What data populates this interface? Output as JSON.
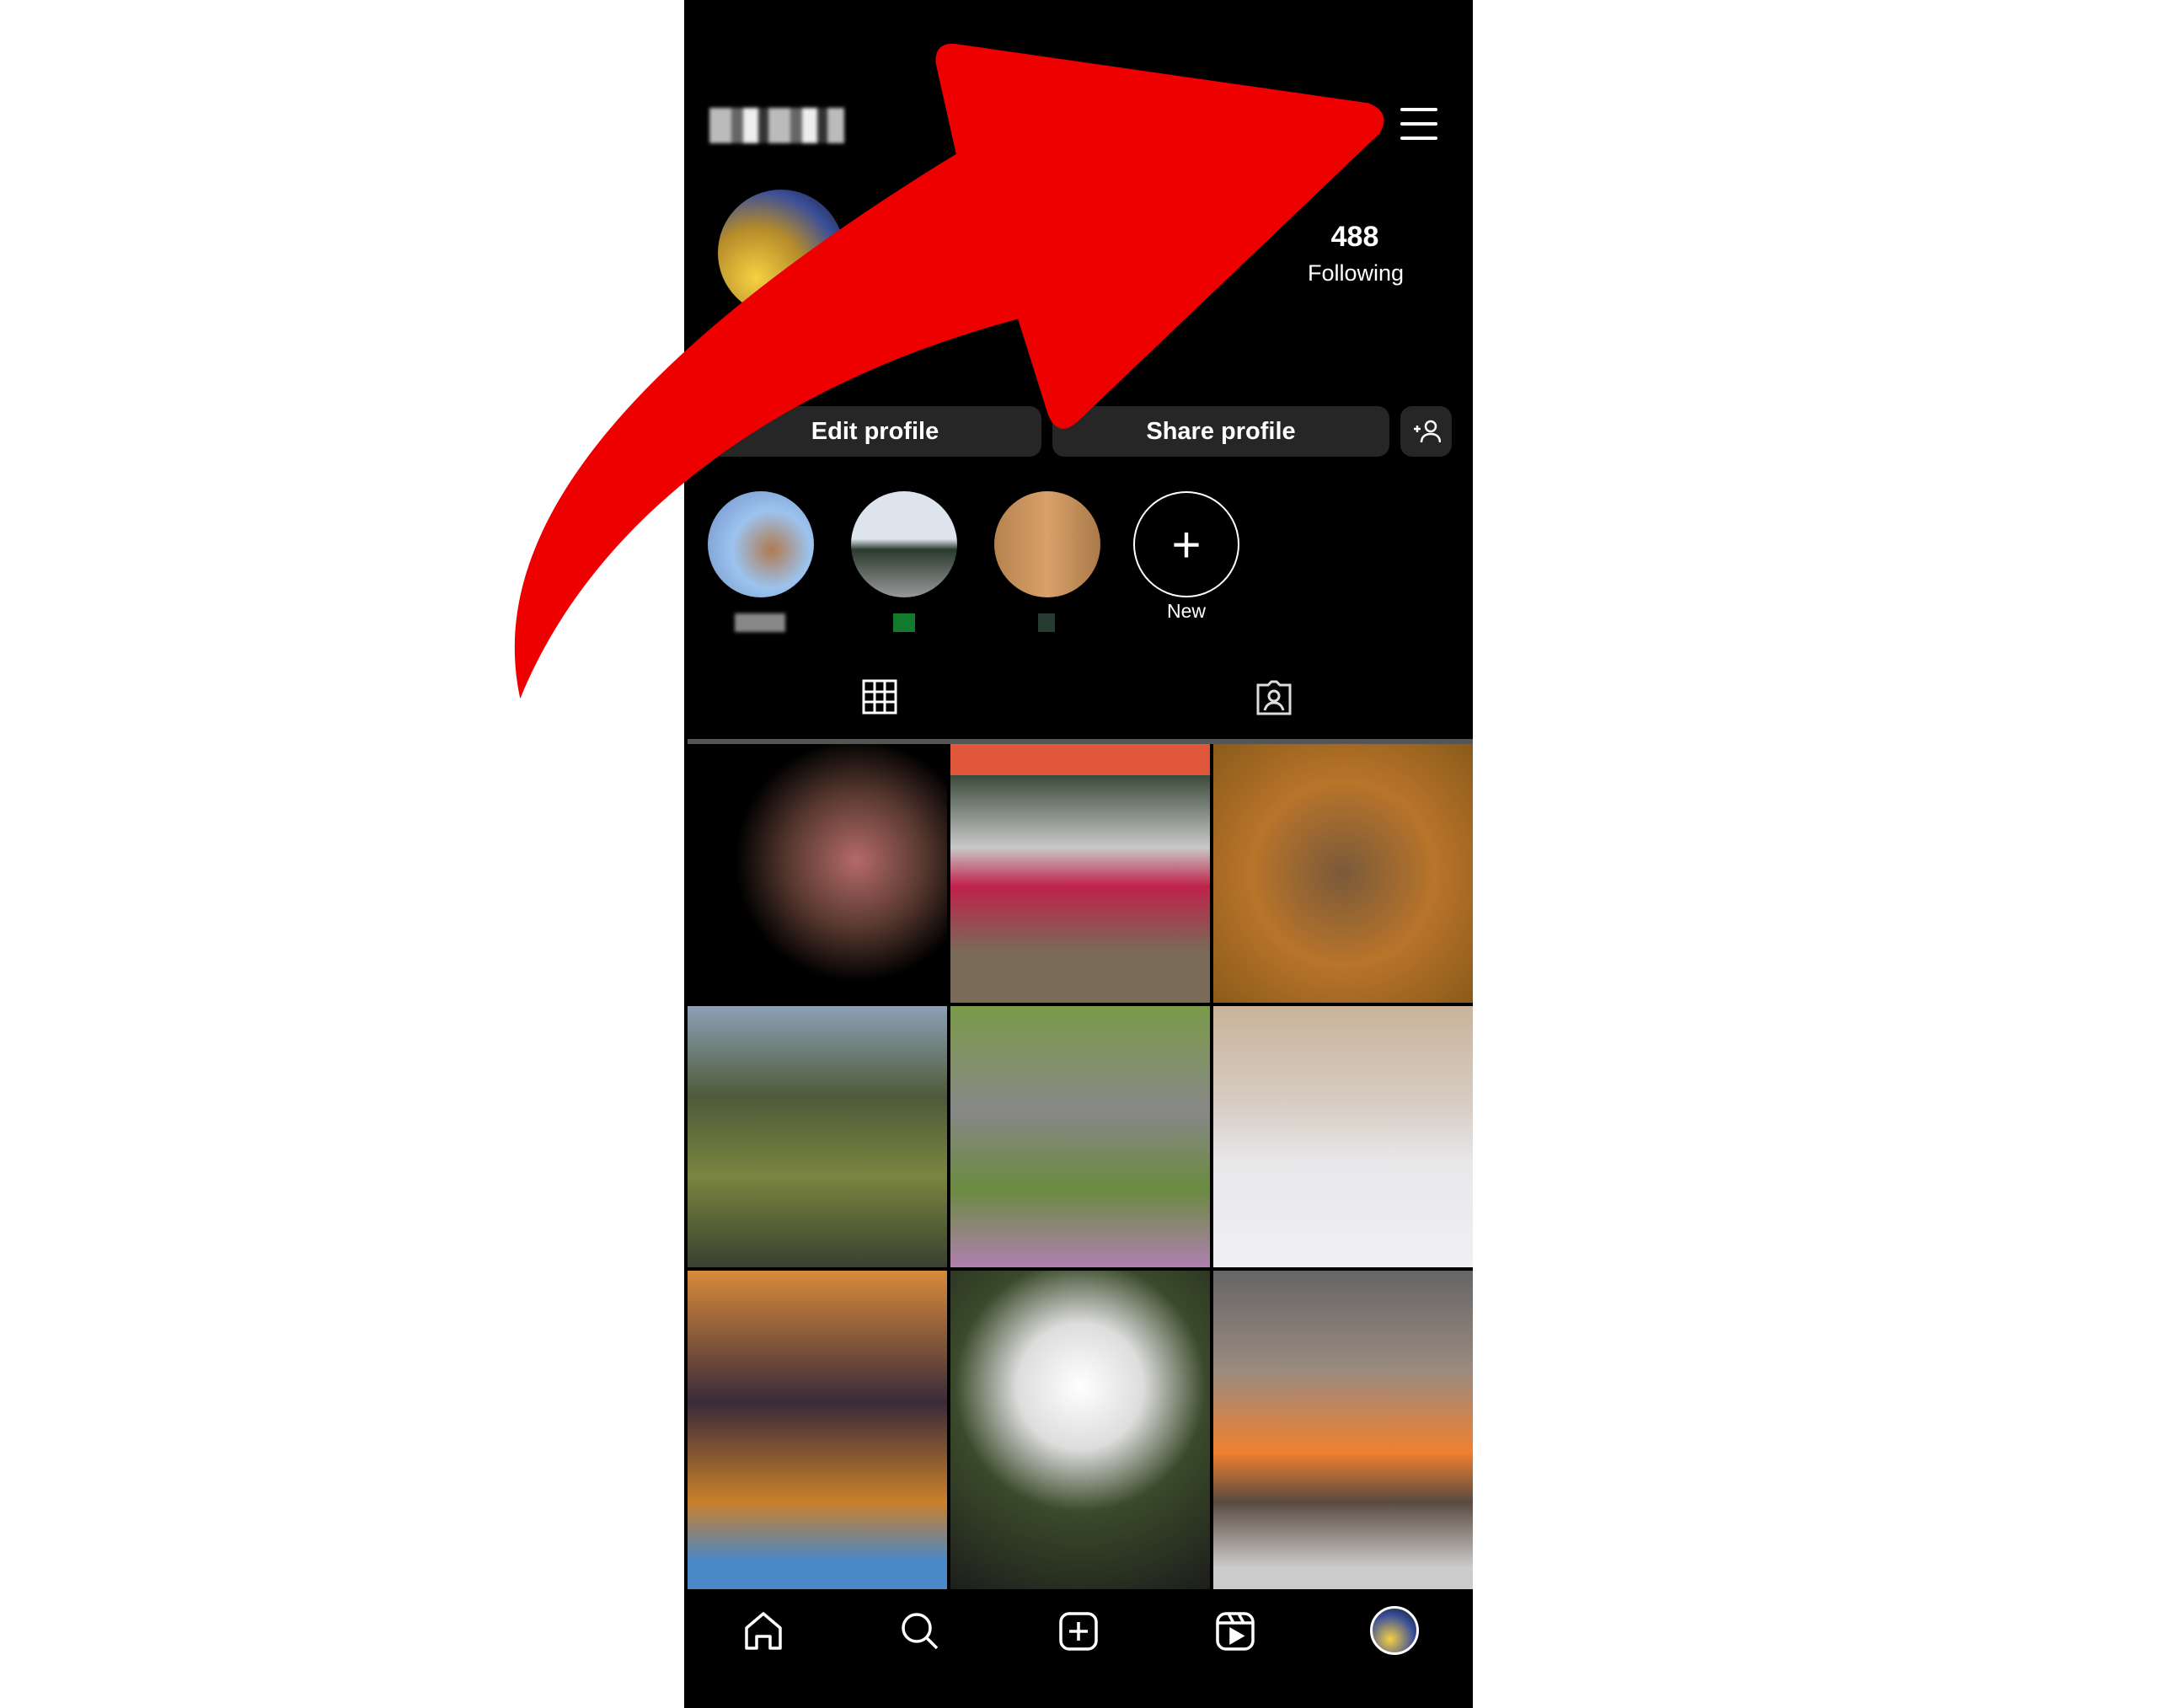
{
  "header": {
    "username": "(blurred)",
    "menu_icon": "hamburger-menu-icon"
  },
  "profile": {
    "following_count": "488",
    "following_label": "Following"
  },
  "buttons": {
    "edit": "Edit profile",
    "share": "Share profile",
    "discover_icon": "add-person-icon"
  },
  "highlights": [
    {
      "label": ""
    },
    {
      "label": ""
    },
    {
      "label": ""
    },
    {
      "label": "New"
    }
  ],
  "tabs": [
    {
      "icon": "grid-icon",
      "active": true
    },
    {
      "icon": "tagged-person-icon",
      "active": false
    }
  ],
  "nav": [
    "home-icon",
    "search-icon",
    "create-icon",
    "reels-icon",
    "profile-avatar"
  ],
  "annotation": {
    "color": "#ee0000",
    "points_to": "hamburger-menu-icon"
  }
}
